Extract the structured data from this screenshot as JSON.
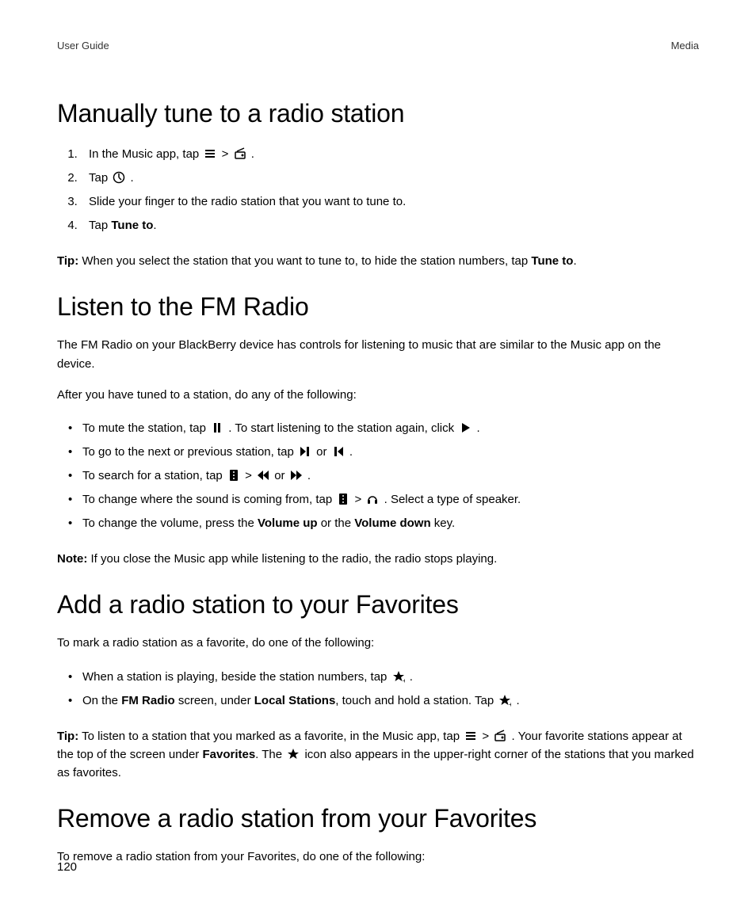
{
  "header": {
    "left": "User Guide",
    "right": "Media"
  },
  "section1": {
    "title": "Manually tune to a radio station",
    "steps": {
      "s1a": "In the Music app, tap ",
      "s1b": " > ",
      "s1c": ".",
      "s2a": "Tap ",
      "s2b": ".",
      "s3": "Slide your finger to the radio station that you want to tune to.",
      "s4a": "Tap ",
      "s4b": "Tune to",
      "s4c": "."
    },
    "tip": {
      "label": "Tip:",
      "text_a": " When you select the station that you want to tune to, to hide the station numbers, tap ",
      "bold": "Tune to",
      "text_b": "."
    }
  },
  "section2": {
    "title": "Listen to the FM Radio",
    "intro": "The FM Radio on your BlackBerry device has controls for listening to music that are similar to the Music app on the device.",
    "lead": "After you have tuned to a station, do any of the following:",
    "items": {
      "i1a": "To mute the station, tap ",
      "i1b": ". To start listening to the station again, click ",
      "i1c": ".",
      "i2a": "To go to the next or previous station, tap ",
      "i2b": " or ",
      "i2c": ".",
      "i3a": "To search for a station, tap ",
      "i3b": " > ",
      "i3c": " or ",
      "i3d": ".",
      "i4a": "To change where the sound is coming from, tap ",
      "i4b": " > ",
      "i4c": ". Select a type of speaker.",
      "i5a": "To change the volume, press the ",
      "i5b": "Volume up",
      "i5c": " or the ",
      "i5d": "Volume down",
      "i5e": " key."
    },
    "note": {
      "label": "Note:",
      "text": " If you close the Music app while listening to the radio, the radio stops playing."
    }
  },
  "section3": {
    "title": "Add a radio station to your Favorites",
    "lead": "To mark a radio station as a favorite, do one of the following:",
    "items": {
      "i1a": "When a station is playing, beside the station numbers, tap ",
      "i1b": ".",
      "i2a": "On the ",
      "i2b": "FM Radio",
      "i2c": " screen, under ",
      "i2d": "Local Stations",
      "i2e": ", touch and hold a station. Tap ",
      "i2f": "."
    },
    "tip": {
      "label": "Tip:",
      "a": " To listen to a station that you marked as a favorite, in the Music app, tap ",
      "b": " > ",
      "c": ". Your favorite stations appear at the top of the screen under ",
      "d": "Favorites",
      "e": ". The ",
      "f": " icon also appears in the upper-right corner of the stations that you marked as favorites."
    }
  },
  "section4": {
    "title": "Remove a radio station from your Favorites",
    "lead": "To remove a radio station from your Favorites, do one of the following:"
  },
  "footer": {
    "page": "120"
  }
}
